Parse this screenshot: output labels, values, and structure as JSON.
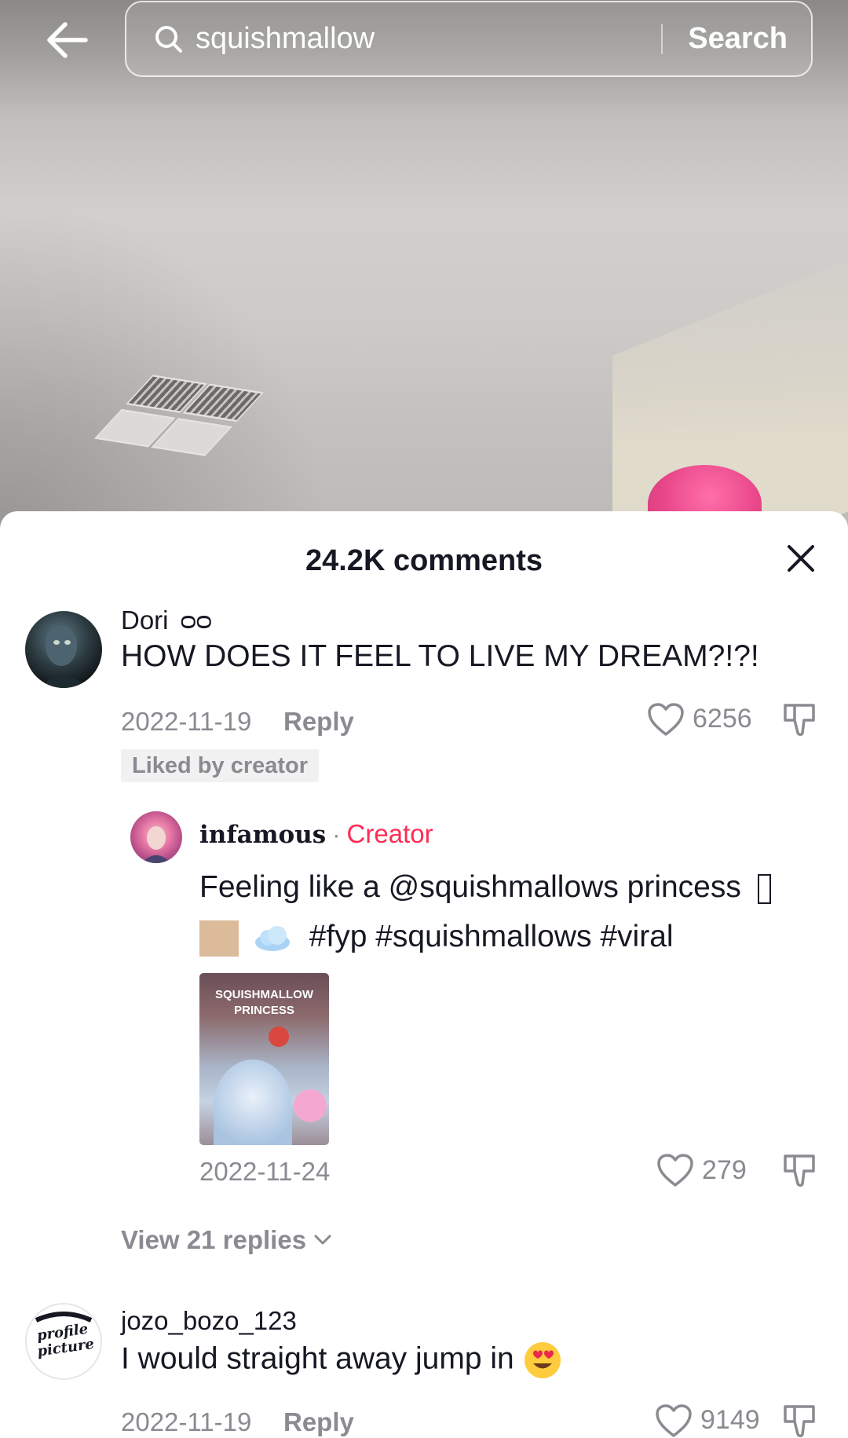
{
  "header": {
    "search_query": "squishmallow",
    "search_button": "Search"
  },
  "comments_panel": {
    "title": "24.2K comments",
    "comments": [
      {
        "username": "Dori",
        "username_suffix": "ᴑᴑ",
        "text": "HOW DOES IT FEEL TO LIVE MY DREAM?!?!",
        "date": "2022-11-19",
        "reply_label": "Reply",
        "likes": "6256",
        "badge": "Liked by creator"
      },
      {
        "username": "jozo_bozo_123",
        "text": "I would straight away jump in",
        "date": "2022-11-19",
        "reply_label": "Reply",
        "likes": "9149",
        "avatar_text": "profile picture"
      }
    ],
    "creator_reply": {
      "username": "infamous",
      "separator": "·",
      "tag": "Creator",
      "text_line1": "Feeling like a @squishmallows princess",
      "text_line2": "#fyp #squishmallows #viral",
      "thumbnail_text": "SQUISHMALLOW PRINCESS",
      "date": "2022-11-24",
      "likes": "279"
    },
    "view_replies": "View 21 replies"
  },
  "colors": {
    "text_primary": "#161823",
    "text_secondary": "#8a8b91",
    "creator_accent": "#fe2c55"
  }
}
